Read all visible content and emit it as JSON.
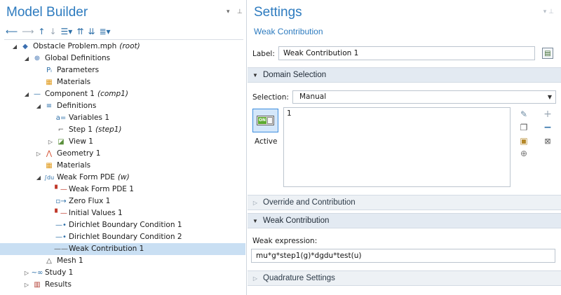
{
  "model_builder": {
    "title": "Model Builder",
    "toolbar": {
      "back_icon": "arrow-left-icon",
      "forward_icon": "arrow-right-icon",
      "up_icon": "arrow-up-icon",
      "down_icon": "arrow-down-icon",
      "view_icon": "view-options-icon",
      "expand_icon": "expand-sections-icon",
      "collapse_icon": "collapse-sections-icon",
      "list_icon": "list-options-icon"
    },
    "tree": [
      {
        "label": "Obstacle Problem.mph",
        "tag": "(root)",
        "depth": 0,
        "twisty": "◢",
        "icon": "model-root-icon",
        "selected": false
      },
      {
        "label": "Global Definitions",
        "tag": "",
        "depth": 1,
        "twisty": "◢",
        "icon": "globe-icon",
        "selected": false
      },
      {
        "label": "Parameters",
        "tag": "",
        "depth": 2,
        "twisty": "",
        "icon": "parameters-icon",
        "selected": false
      },
      {
        "label": "Materials",
        "tag": "",
        "depth": 2,
        "twisty": "",
        "icon": "materials-icon",
        "selected": false
      },
      {
        "label": "Component 1",
        "tag": "(comp1)",
        "depth": 1,
        "twisty": "◢",
        "icon": "component-icon",
        "selected": false
      },
      {
        "label": "Definitions",
        "tag": "",
        "depth": 2,
        "twisty": "◢",
        "icon": "definitions-icon",
        "selected": false
      },
      {
        "label": "Variables 1",
        "tag": "",
        "depth": 3,
        "twisty": "",
        "icon": "variables-icon",
        "selected": false
      },
      {
        "label": "Step 1",
        "tag": "(step1)",
        "depth": 3,
        "twisty": "",
        "icon": "step-function-icon",
        "selected": false
      },
      {
        "label": "View 1",
        "tag": "",
        "depth": 3,
        "twisty": "▷",
        "icon": "view-icon",
        "selected": false
      },
      {
        "label": "Geometry 1",
        "tag": "",
        "depth": 2,
        "twisty": "▷",
        "icon": "geometry-icon",
        "selected": false
      },
      {
        "label": "Materials",
        "tag": "",
        "depth": 2,
        "twisty": "",
        "icon": "materials-icon",
        "selected": false
      },
      {
        "label": "Weak Form PDE",
        "tag": "(w)",
        "depth": 2,
        "twisty": "◢",
        "icon": "weak-form-pde-icon",
        "selected": false
      },
      {
        "label": "Weak Form PDE 1",
        "tag": "",
        "depth": 3,
        "twisty": "",
        "icon": "domain-feature-icon",
        "selected": false
      },
      {
        "label": "Zero Flux 1",
        "tag": "",
        "depth": 3,
        "twisty": "",
        "icon": "boundary-feature-icon",
        "selected": false
      },
      {
        "label": "Initial Values 1",
        "tag": "",
        "depth": 3,
        "twisty": "",
        "icon": "domain-feature-icon",
        "selected": false
      },
      {
        "label": "Dirichlet Boundary Condition 1",
        "tag": "",
        "depth": 3,
        "twisty": "",
        "icon": "boundary-condition-icon",
        "selected": false
      },
      {
        "label": "Dirichlet Boundary Condition 2",
        "tag": "",
        "depth": 3,
        "twisty": "",
        "icon": "boundary-condition-icon",
        "selected": false
      },
      {
        "label": "Weak Contribution 1",
        "tag": "",
        "depth": 3,
        "twisty": "",
        "icon": "weak-contribution-icon",
        "selected": true
      },
      {
        "label": "Mesh 1",
        "tag": "",
        "depth": 2,
        "twisty": "",
        "icon": "mesh-icon",
        "selected": false
      },
      {
        "label": "Study 1",
        "tag": "",
        "depth": 1,
        "twisty": "▷",
        "icon": "study-icon",
        "selected": false
      },
      {
        "label": "Results",
        "tag": "",
        "depth": 1,
        "twisty": "▷",
        "icon": "results-icon",
        "selected": false
      }
    ]
  },
  "settings": {
    "title": "Settings",
    "subtitle": "Weak Contribution",
    "label_caption": "Label:",
    "label_value": "Weak Contribution 1",
    "sections": {
      "domain_selection": "Domain Selection",
      "override": "Override and Contribution",
      "weak_contribution": "Weak Contribution",
      "quadrature": "Quadrature Settings"
    },
    "selection_caption": "Selection:",
    "selection_value": "Manual",
    "active_caption": "Active",
    "toggle_text": "ON",
    "selection_list": [
      "1"
    ],
    "weak_expression_caption": "Weak expression:",
    "weak_expression_value": "mu*g*step1(g)*dgdu*test(u)"
  },
  "colors": {
    "title_blue": "#2d7bbf",
    "selected_row": "#c9dff3",
    "section_header": "#e3eaf2"
  }
}
